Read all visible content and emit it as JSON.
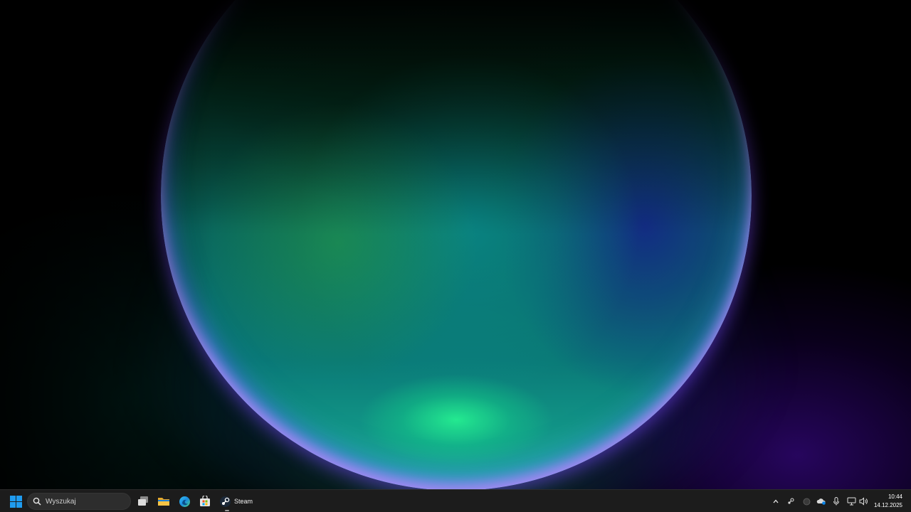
{
  "taskbar": {
    "start_icon": "windows-logo-icon",
    "search": {
      "icon": "search-icon",
      "placeholder": "Wyszukaj"
    },
    "pinned_apps": [
      {
        "name": "task-view",
        "icon": "task-view-icon"
      },
      {
        "name": "file-explorer",
        "icon": "folder-icon"
      },
      {
        "name": "microsoft-edge",
        "icon": "edge-icon"
      },
      {
        "name": "microsoft-store",
        "icon": "store-icon"
      }
    ],
    "running_app": {
      "icon": "steam-icon",
      "label": "Steam"
    },
    "tray": [
      "chevron-up-icon",
      "steam-tray-icon",
      "circle-tray-icon",
      "onedrive-icon",
      "microphone-icon",
      "network-icon",
      "volume-icon"
    ],
    "clock": {
      "time": "10:44",
      "date": "14.12.2025"
    }
  },
  "colors": {
    "taskbar_bg": "#1c1c1c",
    "search_bg": "#2d2d2d",
    "accent_blue": "#0a84e8",
    "folder_yellow": "#f6c344"
  }
}
